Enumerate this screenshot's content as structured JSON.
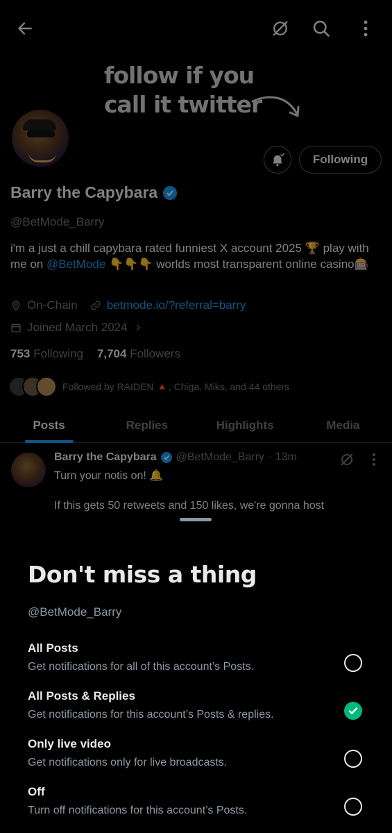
{
  "banner": {
    "line1": "follow if you",
    "line2": "call it twitter"
  },
  "profile": {
    "name": "Barry the Capybara",
    "handle": "@BetMode_Barry",
    "following_button": "Following",
    "bio_part1": "i'm a just a chill capybara  rated funniest X account 2025 🏆  play with me on ",
    "bio_mention": "@BetMode",
    "bio_part2": " 👇👇👇 worlds most transparent online casino🎰",
    "location": "On-Chain",
    "website": "betmode.io/?referral=barry",
    "joined": "Joined March 2024",
    "following_count": "753",
    "following_label": "Following",
    "followers_count": "7,704",
    "followers_label": "Followers",
    "followed_by": "Followed by RAIDEN 🔺, Chiga, Miks, and 44 others"
  },
  "tabs": [
    {
      "label": "Posts",
      "active": true
    },
    {
      "label": "Replies"
    },
    {
      "label": "Highlights"
    },
    {
      "label": "Media"
    }
  ],
  "post": {
    "name": "Barry the Capybara",
    "handle": "@BetMode_Barry",
    "time": "· 13m",
    "line1": "Turn your notis on! 🔔",
    "line2": "If this gets 50 retweets and 150 likes, we're gonna host"
  },
  "sheet": {
    "title": "Don't miss a thing",
    "handle": "@BetMode_Barry",
    "options": [
      {
        "title": "All Posts",
        "desc": "Get notifications for all of this account’s Posts.",
        "selected": false
      },
      {
        "title": "All Posts & Replies",
        "desc": "Get notifications for this account’s Posts & replies.",
        "selected": true
      },
      {
        "title": "Only live video",
        "desc": "Get notifications only for live broadcasts.",
        "selected": false
      },
      {
        "title": "Off",
        "desc": "Turn off notifications for this account’s Posts.",
        "selected": false
      }
    ]
  },
  "colors": {
    "accent": "#1d9bf0",
    "selected": "#00ba7c"
  }
}
